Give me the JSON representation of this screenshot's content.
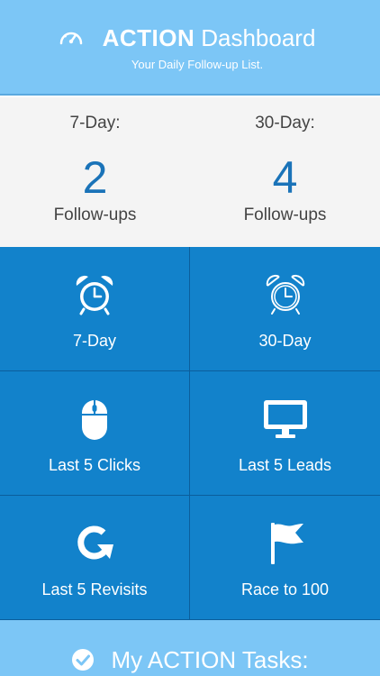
{
  "header": {
    "icon": "gauge-icon",
    "title_bold": "ACTION",
    "title_light": "Dashboard",
    "subtitle": "Your Daily Follow-up List."
  },
  "stats": [
    {
      "label": "7-Day:",
      "value": "2",
      "unit": "Follow-ups"
    },
    {
      "label": "30-Day:",
      "value": "4",
      "unit": "Follow-ups"
    }
  ],
  "tiles": [
    {
      "label": "7-Day",
      "icon": "alarm-clock-icon"
    },
    {
      "label": "30-Day",
      "icon": "alarm-clock-outline-icon"
    },
    {
      "label": "Last 5 Clicks",
      "icon": "mouse-icon"
    },
    {
      "label": "Last 5 Leads",
      "icon": "monitor-icon"
    },
    {
      "label": "Last 5 Revisits",
      "icon": "refresh-icon"
    },
    {
      "label": "Race to 100",
      "icon": "flag-icon"
    }
  ],
  "footer": {
    "icon": "check-circle-icon",
    "text": "My ACTION Tasks:"
  },
  "colors": {
    "header_bg": "#7cc6f6",
    "stat_value": "#1a73b8",
    "tile_bg": "#1282cb",
    "tile_border": "#0b5e9c"
  }
}
